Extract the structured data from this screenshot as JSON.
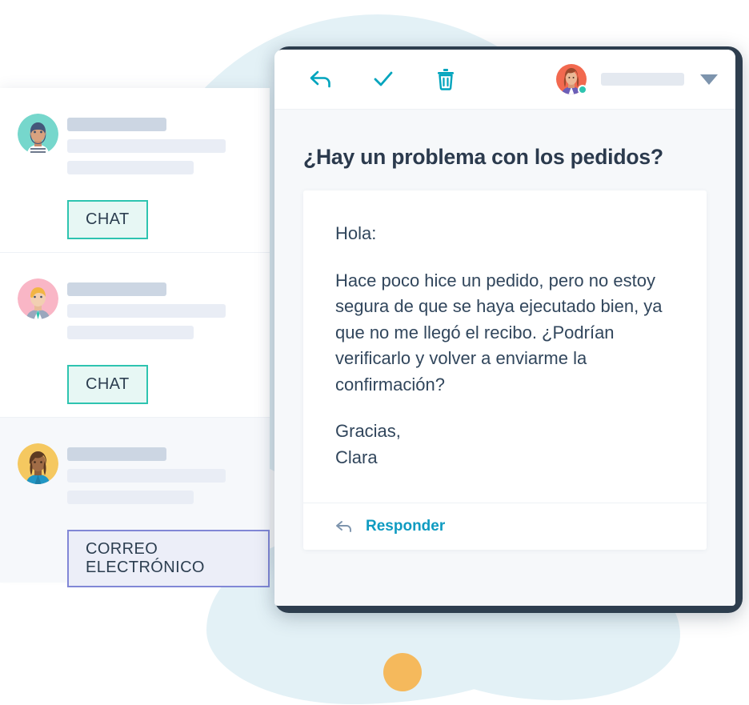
{
  "colors": {
    "teal_icon": "#00a4bd",
    "accent_link": "#0f9bc1",
    "chat_badge_border": "#2ec4b0",
    "email_badge_border": "#8187d6",
    "heading": "#2b3a4d",
    "body_text": "#31465c",
    "blob_blue": "#e3f1f6",
    "dot_orange": "#f5b95c",
    "device_frame": "#2e3e4e",
    "status_online": "#2ec4b0"
  },
  "conversation_list": {
    "items": [
      {
        "avatar_name": "avatar-bearded-man",
        "avatar_bg": "#76d7cc",
        "badge_label": "CHAT",
        "badge_type": "chat",
        "selected": false
      },
      {
        "avatar_name": "avatar-blond-man",
        "avatar_bg": "#f9b6c6",
        "badge_label": "CHAT",
        "badge_type": "chat",
        "selected": false
      },
      {
        "avatar_name": "avatar-woman-dark-hair",
        "avatar_bg": "#f5c860",
        "badge_label": "CORREO ELECTRÓNICO",
        "badge_type": "email",
        "selected": true
      }
    ]
  },
  "email": {
    "toolbar": {
      "reply_icon": "reply-arrow-icon",
      "done_icon": "checkmark-icon",
      "delete_icon": "trash-icon",
      "avatar_name": "avatar-red-haired-woman",
      "status": "online",
      "dropdown_icon": "chevron-down-icon"
    },
    "subject": "¿Hay un problema con los pedidos?",
    "body_paragraphs": [
      "Hola:",
      "Hace poco hice un pedido, pero no estoy segura de que se haya ejecutado bien, ya que no me llegó el recibo. ¿Podrían verificarlo y volver a enviarme la confirmación?",
      "Gracias,\nClara"
    ],
    "footer": {
      "reply_icon": "reply-arrow-icon",
      "reply_label": "Responder"
    }
  }
}
